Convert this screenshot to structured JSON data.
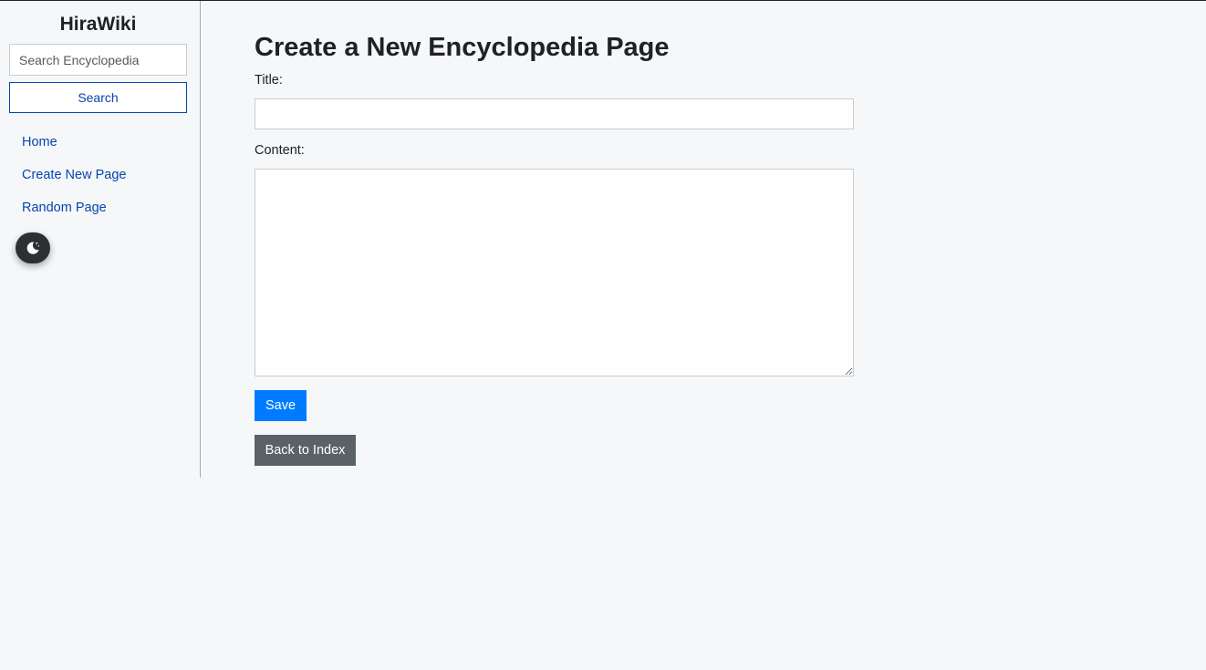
{
  "sidebar": {
    "site_title": "HiraWiki",
    "search_placeholder": "Search Encyclopedia",
    "search_button": "Search",
    "nav": [
      {
        "label": "Home"
      },
      {
        "label": "Create New Page"
      },
      {
        "label": "Random Page"
      }
    ],
    "theme_toggle_icon": "moon-icon"
  },
  "main": {
    "page_title": "Create a New Encyclopedia Page",
    "title_label": "Title:",
    "title_value": "",
    "content_label": "Content:",
    "content_value": "",
    "save_button": "Save",
    "back_button": "Back to Index"
  },
  "colors": {
    "link": "#0645ad",
    "save": "#007bff",
    "back": "#5a6268",
    "background": "#f6f7f9",
    "toggle": "#2b3035"
  }
}
